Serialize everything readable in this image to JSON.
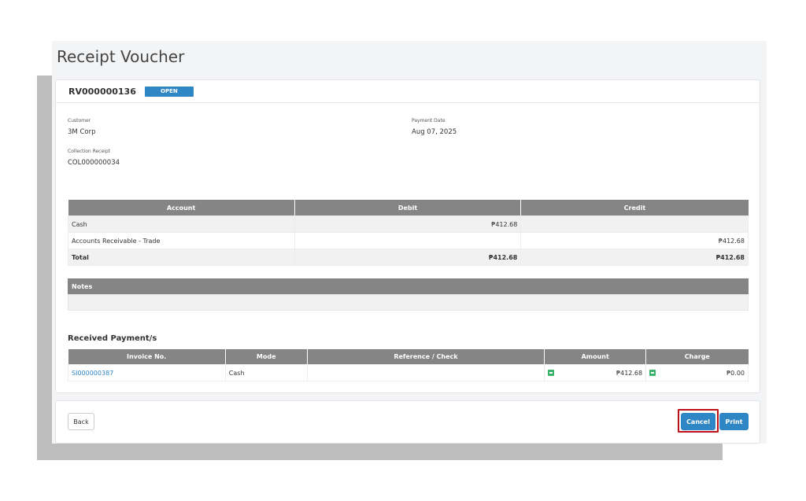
{
  "page_title": "Receipt Voucher",
  "voucher": {
    "number": "RV000000136",
    "status": "OPEN"
  },
  "fields": {
    "customer_label": "Customer",
    "customer_value": "3M Corp",
    "payment_date_label": "Payment Date",
    "payment_date_value": "Aug 07, 2025",
    "collection_label": "Collection Receipt",
    "collection_value": "COL000000034"
  },
  "accounts_table": {
    "headers": [
      "Account",
      "Debit",
      "Credit"
    ],
    "rows": [
      {
        "account": "Cash",
        "debit": "₱412.68",
        "credit": ""
      },
      {
        "account": "Accounts Receivable - Trade",
        "debit": "",
        "credit": "₱412.68"
      }
    ],
    "total": {
      "label": "Total",
      "debit": "₱412.68",
      "credit": "₱412.68"
    }
  },
  "notes": {
    "header": "Notes",
    "content": ""
  },
  "payments": {
    "title": "Received Payment/s",
    "headers": [
      "Invoice No.",
      "Mode",
      "Reference / Check",
      "Amount",
      "Charge"
    ],
    "rows": [
      {
        "invoice": "SI000000387",
        "mode": "Cash",
        "reference": "",
        "amount": "₱412.68",
        "charge": "₱0.00"
      }
    ]
  },
  "buttons": {
    "back": "Back",
    "cancel": "Cancel",
    "print": "Print"
  },
  "colors": {
    "primary": "#2f86c5",
    "table_header": "#858585",
    "highlight": "#c0101a",
    "icon_green": "#3ab26a"
  },
  "icons": {
    "amount_calc": "calculator-icon",
    "charge_calc": "calculator-icon"
  }
}
